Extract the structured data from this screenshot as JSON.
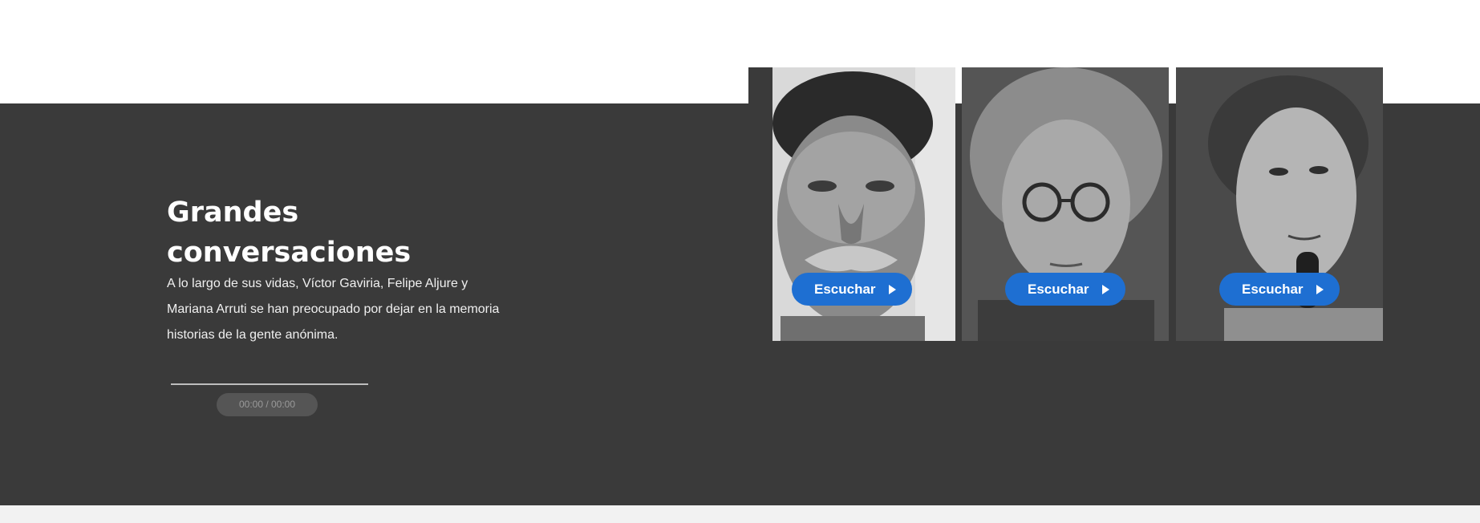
{
  "section": {
    "title_line1": "Grandes",
    "title_line2": "conversaciones",
    "description": "A lo largo de sus vidas, Víctor Gaviria, Felipe Aljure y Mariana Arruti se han preocupado por dejar en la memoria historias de la gente anónima."
  },
  "player": {
    "time": "00:00 / 00:00"
  },
  "cards": [
    {
      "button_label": "Escuchar",
      "icon": "play-icon"
    },
    {
      "button_label": "Escuchar",
      "icon": "play-icon"
    },
    {
      "button_label": "Escuchar",
      "icon": "play-icon"
    }
  ],
  "colors": {
    "band": "#3a3a3a",
    "button": "#1e6fd2",
    "text": "#ffffff"
  }
}
